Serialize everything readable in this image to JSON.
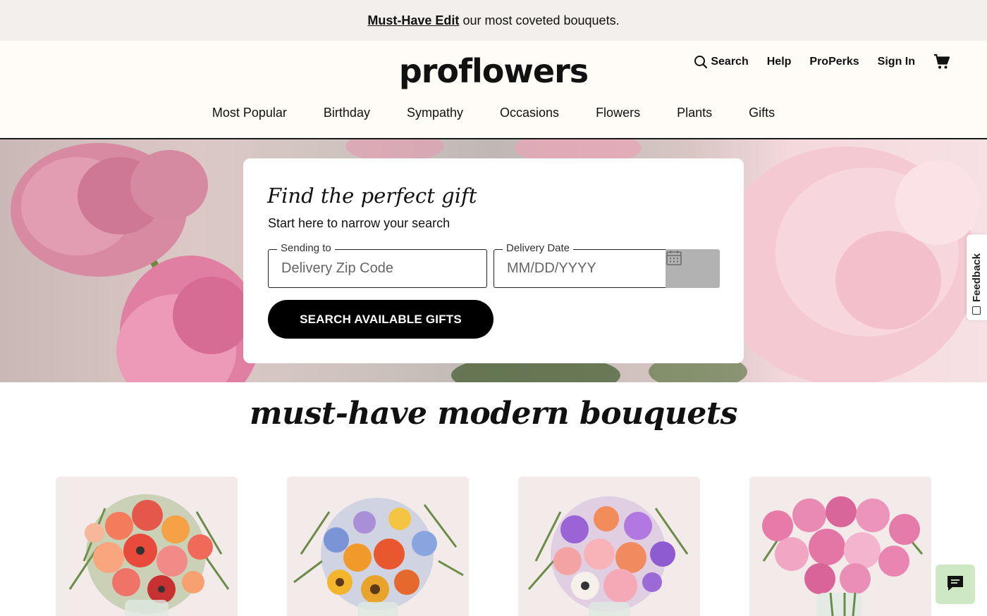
{
  "promo": {
    "link_text": "Must-Have Edit",
    "text": "our most coveted bouquets."
  },
  "header": {
    "logo": "proflowers",
    "util": {
      "search": "Search",
      "help": "Help",
      "properks": "ProPerks",
      "signin": "Sign In"
    },
    "nav": [
      "Most Popular",
      "Birthday",
      "Sympathy",
      "Occasions",
      "Flowers",
      "Plants",
      "Gifts"
    ]
  },
  "hero": {
    "title": "Find the perfect gift",
    "subtitle": "Start here to narrow your search",
    "zip_label": "Sending to",
    "zip_placeholder": "Delivery Zip Code",
    "date_label": "Delivery Date",
    "date_placeholder": "MM/DD/YYYY",
    "search_button": "SEARCH AVAILABLE GIFTS"
  },
  "feedback_label": "Feedback",
  "section": {
    "title": "must-have modern bouquets"
  },
  "colors": {
    "promo_bg": "#f2efec",
    "header_bg": "#fffcf7",
    "button": "#000000",
    "chat_bg": "#cfe8c4"
  },
  "icons": [
    "search-icon",
    "cart-icon",
    "calendar-icon",
    "chat-icon",
    "feedback-icon"
  ]
}
